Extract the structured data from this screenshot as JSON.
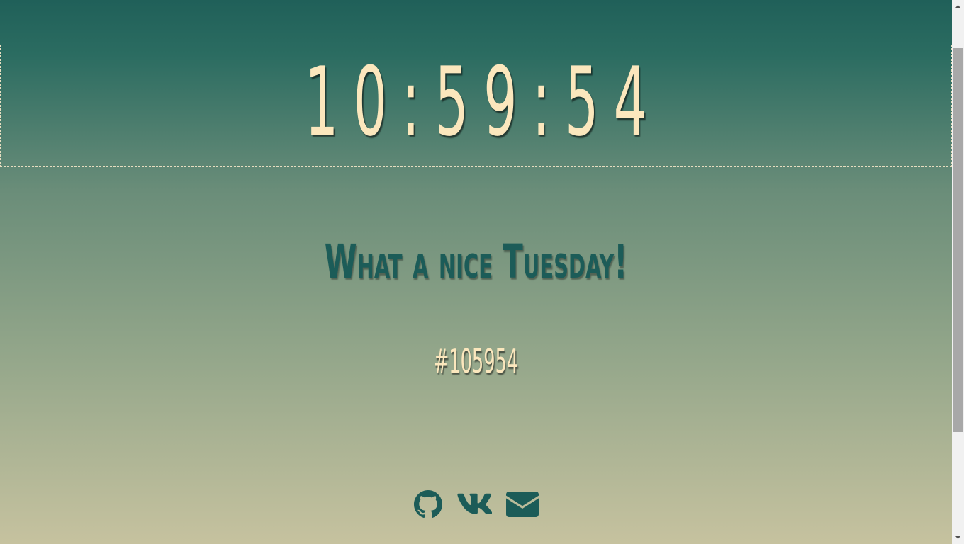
{
  "clock": {
    "time": "10:59:54"
  },
  "greeting": {
    "text": "What a nice Tuesday!"
  },
  "color_code": {
    "text": "#105954"
  },
  "social": {
    "items": [
      {
        "name": "github-icon"
      },
      {
        "name": "vk-icon"
      },
      {
        "name": "envelope-icon"
      }
    ]
  },
  "colors": {
    "accent_text": "#fbe7bd",
    "dark_teal": "#1c5c58",
    "gradient_top": "#206059",
    "gradient_bottom": "#c6c29f"
  }
}
